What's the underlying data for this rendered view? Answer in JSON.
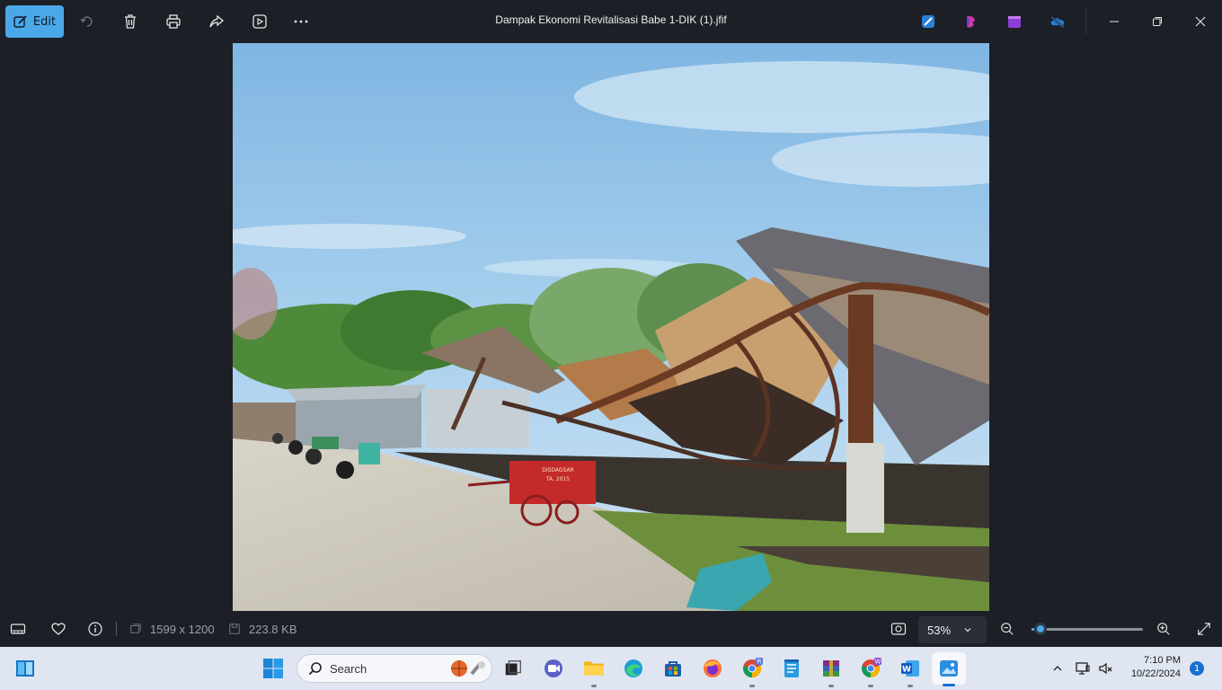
{
  "toolbar": {
    "edit_label": "Edit",
    "title": "Dampak Ekonomi Revitalisasi Babe 1-DIK (1).jfif"
  },
  "statusbar": {
    "dimensions": "1599 x 1200",
    "file_size": "223.8 KB",
    "zoom": "53%",
    "zoom_level": 0.08
  },
  "photo": {
    "cart_sign_line1": "DISDAGSAR",
    "cart_sign_line2": "TA. 2015"
  },
  "taskbar": {
    "search_placeholder": "Search",
    "time": "7:10 PM",
    "date": "10/22/2024",
    "notification_count": "1"
  },
  "colors": {
    "accent": "#4aa8e8",
    "background": "#1c1f26",
    "taskbar": "#dfe6f1"
  }
}
